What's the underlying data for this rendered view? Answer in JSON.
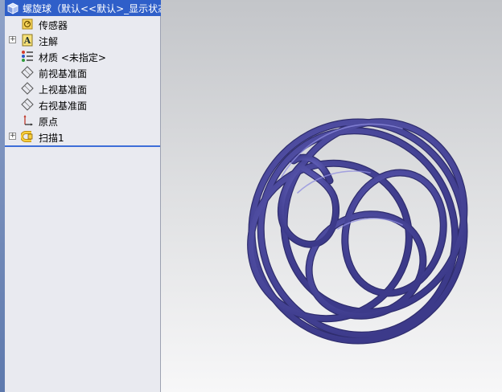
{
  "tree": {
    "root_label": "螺旋球（默认<<默认>_显示状态",
    "items": [
      {
        "label": "传感器",
        "icon": "sensor-icon",
        "expandable": false
      },
      {
        "label": "注解",
        "icon": "annotation-icon",
        "expandable": true
      },
      {
        "label": "材质 <未指定>",
        "icon": "material-icon",
        "expandable": false
      },
      {
        "label": "前视基准面",
        "icon": "plane-icon",
        "expandable": false
      },
      {
        "label": "上视基准面",
        "icon": "plane-icon",
        "expandable": false
      },
      {
        "label": "右视基准面",
        "icon": "plane-icon",
        "expandable": false
      },
      {
        "label": "原点",
        "icon": "origin-icon",
        "expandable": false
      },
      {
        "label": "扫描1",
        "icon": "sweep-feature-icon",
        "expandable": true
      }
    ]
  },
  "colors": {
    "selection": "#2f5fc9",
    "model": "#4d4ba3"
  }
}
